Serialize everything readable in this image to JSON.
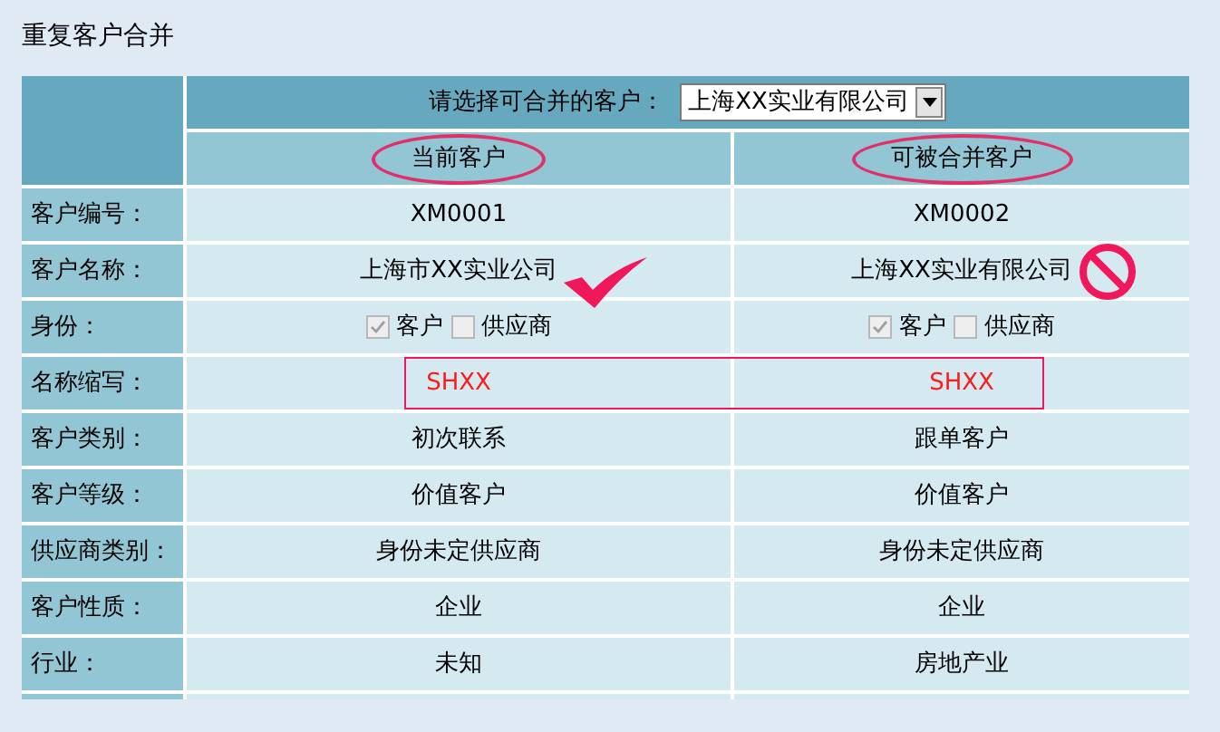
{
  "title": "重复客户合并",
  "selector": {
    "label": "请选择可合并的客户：",
    "value": "上海XX实业有限公司"
  },
  "columns": [
    {
      "label": "当前客户",
      "circled": true
    },
    {
      "label": "可被合并客户",
      "circled": true
    }
  ],
  "rows": [
    {
      "kind": "text",
      "label": "客户编号：",
      "values": [
        {
          "text": "XM0001"
        },
        {
          "text": "XM0002"
        }
      ]
    },
    {
      "kind": "text",
      "label": "客户名称：",
      "values": [
        {
          "text": "上海市XX实业公司",
          "check_mark": true
        },
        {
          "text": "上海XX实业有限公司",
          "forbidden_mark": true
        }
      ]
    },
    {
      "kind": "checkboxes",
      "label": "身份：",
      "values": [
        {
          "options": [
            {
              "label": "客户",
              "checked": true,
              "disabled": true
            },
            {
              "label": "供应商",
              "checked": false,
              "disabled": true
            }
          ]
        },
        {
          "options": [
            {
              "label": "客户",
              "checked": true,
              "disabled": true
            },
            {
              "label": "供应商",
              "checked": false,
              "disabled": true
            }
          ]
        }
      ]
    },
    {
      "kind": "boxed",
      "label": "名称缩写：",
      "values": [
        {
          "text": "SHXX"
        },
        {
          "text": "SHXX"
        }
      ]
    },
    {
      "kind": "text",
      "label": "客户类别：",
      "values": [
        {
          "text": "初次联系"
        },
        {
          "text": "跟单客户"
        }
      ]
    },
    {
      "kind": "text",
      "label": "客户等级：",
      "values": [
        {
          "text": "价值客户"
        },
        {
          "text": "价值客户"
        }
      ]
    },
    {
      "kind": "text",
      "label": "供应商类别：",
      "values": [
        {
          "text": "身份未定供应商"
        },
        {
          "text": "身份未定供应商"
        }
      ]
    },
    {
      "kind": "text",
      "label": "客户性质：",
      "values": [
        {
          "text": "企业"
        },
        {
          "text": "企业"
        }
      ]
    },
    {
      "kind": "text",
      "label": "行业：",
      "values": [
        {
          "text": "未知"
        },
        {
          "text": "房地产业"
        }
      ]
    }
  ]
}
